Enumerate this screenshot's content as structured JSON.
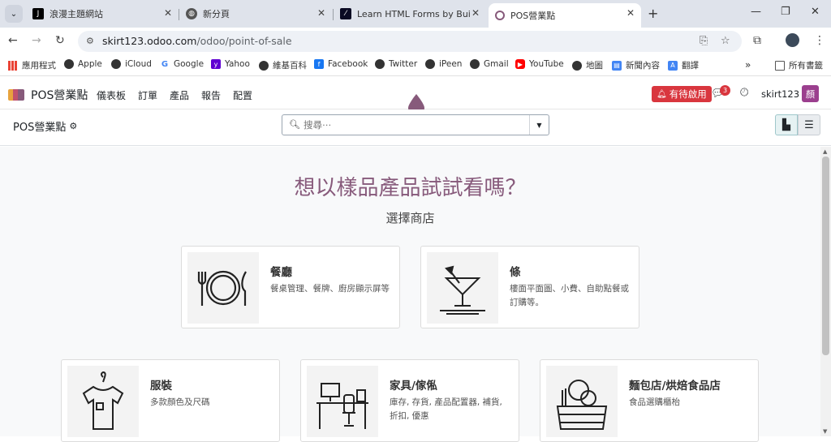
{
  "browser": {
    "tabs": [
      {
        "title": "浪漫主題網站",
        "icon": "jetbrains-icon",
        "color": "#000000"
      },
      {
        "title": "新分頁",
        "icon": "globe-icon",
        "color": "#444444"
      },
      {
        "title": "Learn HTML Forms by Building",
        "icon": "freecodecamp-icon",
        "color": "#0a0a23"
      },
      {
        "title": "POS營業點",
        "icon": "odoo-icon",
        "color": "#875a7b",
        "active": true
      }
    ],
    "url_host": "skirt123.odoo.com",
    "url_path": "/odoo/point-of-sale",
    "bookmarks": [
      {
        "label": "應用程式",
        "icon": "apps-grid-icon"
      },
      {
        "label": "Apple",
        "icon": "globe-icon"
      },
      {
        "label": "iCloud",
        "icon": "globe-icon"
      },
      {
        "label": "Google",
        "icon": "google-icon"
      },
      {
        "label": "Yahoo",
        "icon": "yahoo-icon"
      },
      {
        "label": "維基百科",
        "icon": "globe-icon"
      },
      {
        "label": "Facebook",
        "icon": "facebook-icon"
      },
      {
        "label": "Twitter",
        "icon": "globe-icon"
      },
      {
        "label": "iPeen",
        "icon": "globe-icon"
      },
      {
        "label": "Gmail",
        "icon": "globe-icon"
      },
      {
        "label": "YouTube",
        "icon": "youtube-icon"
      },
      {
        "label": "地圖",
        "icon": "globe-icon"
      },
      {
        "label": "新聞內容",
        "icon": "news-icon"
      },
      {
        "label": "翻譯",
        "icon": "translate-icon"
      }
    ],
    "bookmarks_more": "»",
    "all_bookmarks": "所有書籤"
  },
  "app": {
    "brand": "POS營業點",
    "menu": [
      "儀表板",
      "訂單",
      "產品",
      "報告",
      "配置"
    ],
    "activity_button": "有待啟用",
    "chat_count": "3",
    "username": "skirt123",
    "avatar_letter": "顏"
  },
  "control": {
    "breadcrumb": "POS營業點",
    "search_placeholder": "搜尋⋯"
  },
  "main": {
    "headline": "想以樣品產品試試看嗎？",
    "subline": "選擇商店",
    "cards": [
      {
        "title": "餐廳",
        "desc": "餐桌管理、餐牌、廚房顯示屏等",
        "icon": "plate-cutlery-icon"
      },
      {
        "title": "條",
        "desc": "樓面平面圖、小費、自助點餐或訂購等。",
        "icon": "cocktail-icon"
      },
      {
        "title": "服裝",
        "desc": "多款顏色及尺碼",
        "icon": "tshirt-hanger-icon"
      },
      {
        "title": "家具/傢俬",
        "desc": "庫存, 存貨, 產品配置器, 補貨, 折扣, 優惠",
        "icon": "desk-chair-icon"
      },
      {
        "title": "麵包店/烘焙食品店",
        "desc": "食品選購櫃枱",
        "icon": "bread-basket-icon"
      }
    ]
  },
  "colors": {
    "accent": "#875a7b",
    "danger": "#d9363e",
    "teal": "#017e84"
  }
}
